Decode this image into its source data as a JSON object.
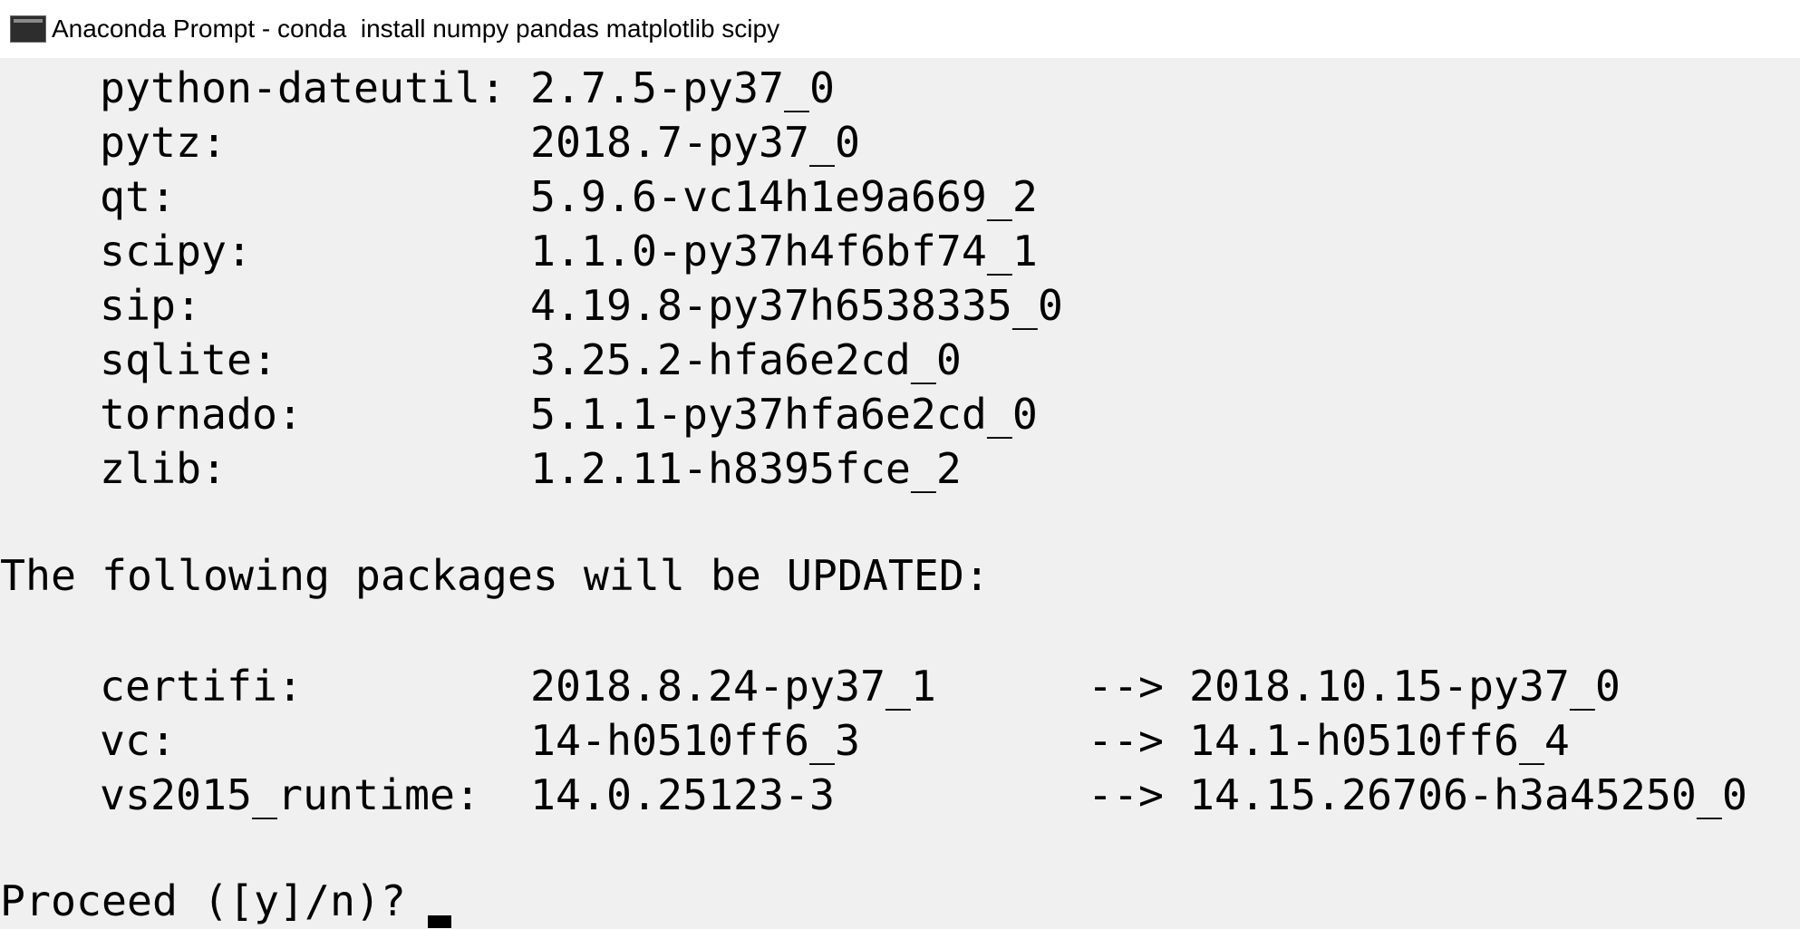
{
  "window": {
    "title": "Anaconda Prompt - conda  install numpy pandas matplotlib scipy",
    "icon": "console-icon"
  },
  "console": {
    "installed_packages": [
      {
        "name": "python-dateutil:",
        "version": "2.7.5-py37_0"
      },
      {
        "name": "pytz:",
        "version": "2018.7-py37_0"
      },
      {
        "name": "qt:",
        "version": "5.9.6-vc14h1e9a669_2"
      },
      {
        "name": "scipy:",
        "version": "1.1.0-py37h4f6bf74_1"
      },
      {
        "name": "sip:",
        "version": "4.19.8-py37h6538335_0"
      },
      {
        "name": "sqlite:",
        "version": "3.25.2-hfa6e2cd_0"
      },
      {
        "name": "tornado:",
        "version": "5.1.1-py37hfa6e2cd_0"
      },
      {
        "name": "zlib:",
        "version": "1.2.11-h8395fce_2"
      }
    ],
    "updated_heading": "The following packages will be UPDATED:",
    "updated_packages": [
      {
        "name": "certifi:",
        "old_version": "2018.8.24-py37_1",
        "arrow": "-->",
        "new_version": "2018.10.15-py37_0"
      },
      {
        "name": "vc:",
        "old_version": "14-h0510ff6_3",
        "arrow": "-->",
        "new_version": "14.1-h0510ff6_4"
      },
      {
        "name": "vs2015_runtime:",
        "old_version": "14.0.25123-3",
        "arrow": "-->",
        "new_version": "14.15.26706-h3a45250_0"
      }
    ],
    "prompt": "Proceed ([y]/n)? "
  }
}
